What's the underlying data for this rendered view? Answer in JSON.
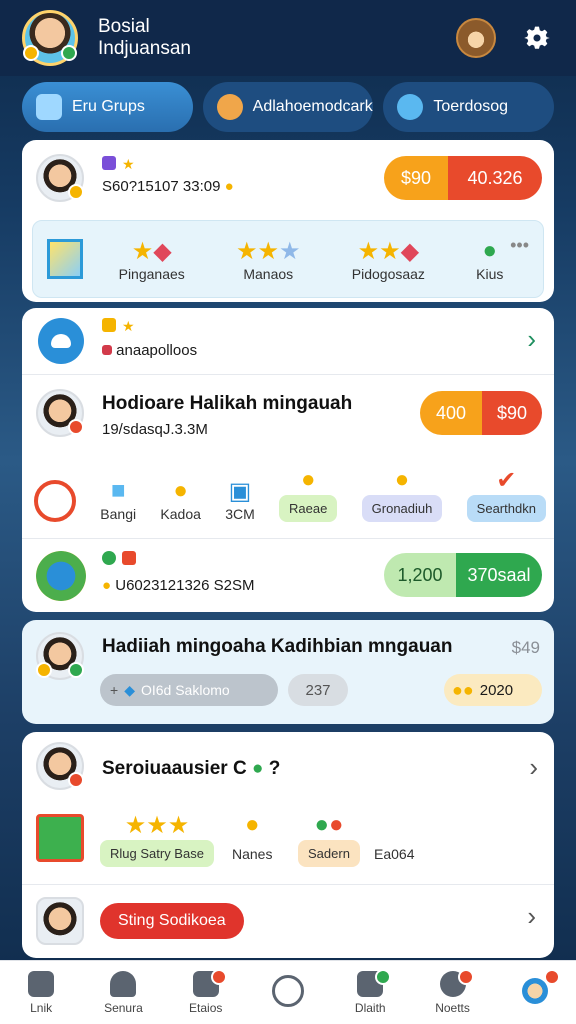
{
  "header": {
    "title_line1": "Bosial",
    "title_line2": "Indjuansan"
  },
  "tabs": [
    {
      "label": "Eru Grups"
    },
    {
      "label": "Adlahoemodcark"
    },
    {
      "label": "Toerdosog"
    }
  ],
  "card1": {
    "info": "S60?15107 33:09",
    "pill_left": "$90",
    "pill_right": "40.326",
    "items": [
      "Pinganaes",
      "Manaos",
      "Pidogosaaz",
      "Kius"
    ]
  },
  "card2": {
    "text": "anaapolloos"
  },
  "card3": {
    "title": "Hodioare Halikah mingauah",
    "sub": "19/sdasqJ.3.3M",
    "pill_left": "400",
    "pill_right": "$90",
    "items": [
      "Bangi",
      "Kadoa",
      "3CM"
    ],
    "chips": [
      "Raeae",
      "Gronadiuh",
      "Searthdkn"
    ]
  },
  "card4": {
    "info": "U6023121326 S2SM",
    "pill_left": "1,200",
    "pill_right": "370saal"
  },
  "card5": {
    "title": "Hadiiah mingoaha Kadihbian mngauan",
    "price": "$49",
    "chip_left": "OI6d Saklomo",
    "chip_mid": "237",
    "chip_right": "2020"
  },
  "card6": {
    "title": "Seroiuaausier C",
    "chip_a": "Rlug Satry Base",
    "item_b": "Nanes",
    "chip_c": "Sadern",
    "item_d": "Ea064"
  },
  "card7": {
    "button": "Sting Sodikoea"
  },
  "nav": [
    {
      "label": "Lnik"
    },
    {
      "label": "Senura"
    },
    {
      "label": "Etaios"
    },
    {
      "label": ""
    },
    {
      "label": "Dlaith"
    },
    {
      "label": "Noetts"
    },
    {
      "label": ""
    }
  ],
  "colors": {
    "header_bg": "#10284a",
    "pill_orange": "#f7a21b",
    "pill_red": "#e84a2c",
    "green": "#2fa84f",
    "accent_blue": "#2a6fb0"
  }
}
